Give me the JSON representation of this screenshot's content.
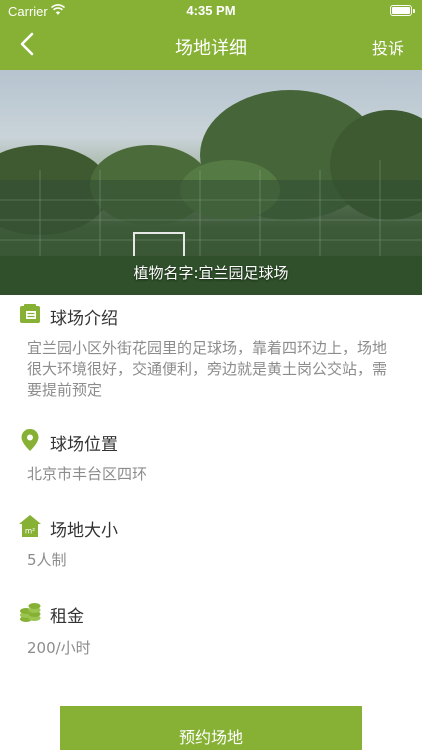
{
  "status": {
    "carrier": "Carrier",
    "time": "4:35 PM"
  },
  "nav": {
    "title": "场地详细",
    "complain_label": "投诉"
  },
  "hero": {
    "caption": "植物名字:宜兰园足球场"
  },
  "sections": [
    {
      "title": "球场介绍",
      "body": "宜兰园小区外街花园里的足球场，靠着四环边上，场地很大环境很好，交通便利，旁边就是黄土岗公交站，需要提前预定",
      "icon": "document-icon"
    },
    {
      "title": "球场位置",
      "body": "北京市丰台区四环",
      "icon": "location-pin-icon"
    },
    {
      "title": "场地大小",
      "body": "5人制",
      "icon": "area-house-icon"
    },
    {
      "title": "租金",
      "body": "200/小时",
      "icon": "coins-icon"
    }
  ],
  "area_icon_label": "m²",
  "book_button_label": "预约场地",
  "colors": {
    "brand": "#86b135",
    "muted_text": "#8c8c8c"
  }
}
